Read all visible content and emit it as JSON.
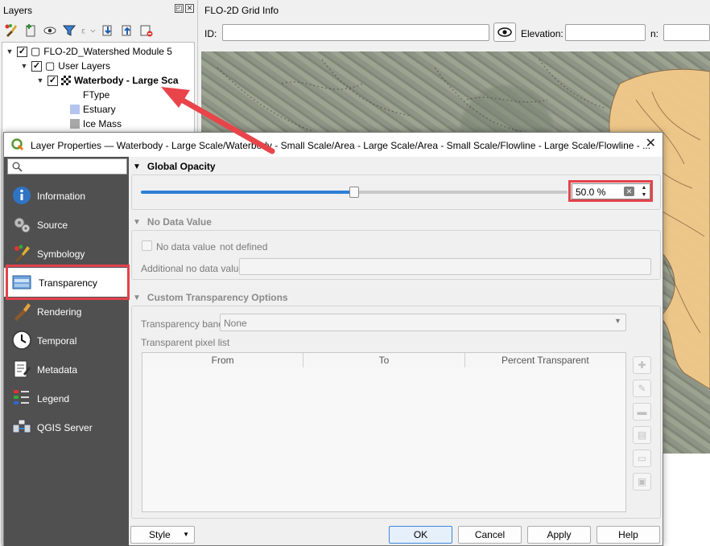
{
  "layers_panel": {
    "title": "Layers",
    "tree": [
      {
        "label": "FLO-2D_Watershed Module 5",
        "checked": true,
        "expanded": true
      },
      {
        "label": "User Layers",
        "checked": true,
        "expanded": true
      },
      {
        "label": "Waterbody - Large Sca",
        "checked": true,
        "expanded": true
      }
    ],
    "legend": {
      "field": "FType",
      "items": [
        {
          "label": "Estuary",
          "color": "#b4c4f0"
        },
        {
          "label": "Ice Mass",
          "color": "#a8a8a8"
        }
      ]
    }
  },
  "grid_info": {
    "title": "FLO-2D Grid Info",
    "id_label": "ID:",
    "id_value": "",
    "elevation_label": "Elevation:",
    "elevation_value": "",
    "n_label": "n:",
    "n_value": ""
  },
  "dialog": {
    "title": "Layer Properties — Waterbody - Large Scale/Waterbody - Small Scale/Area - Large Scale/Area - Small Scale/Flowline - Large Scale/Flowline - ...",
    "close": "✕",
    "search_placeholder": "",
    "nav": [
      {
        "label": "Information",
        "icon": "information-icon"
      },
      {
        "label": "Source",
        "icon": "source-icon"
      },
      {
        "label": "Symbology",
        "icon": "symbology-icon"
      },
      {
        "label": "Transparency",
        "icon": "transparency-icon",
        "selected": true
      },
      {
        "label": "Rendering",
        "icon": "rendering-icon"
      },
      {
        "label": "Temporal",
        "icon": "temporal-icon"
      },
      {
        "label": "Metadata",
        "icon": "metadata-icon"
      },
      {
        "label": "Legend",
        "icon": "legend-icon"
      },
      {
        "label": "QGIS Server",
        "icon": "qgis-server-icon"
      }
    ],
    "global_opacity": {
      "title": "Global Opacity",
      "value_text": "50.0 %",
      "value": 0.5
    },
    "no_data": {
      "title": "No Data Value",
      "checkbox_label": "No data value",
      "status": "not defined",
      "additional_label": "Additional no data value",
      "additional_value": ""
    },
    "custom_transparency": {
      "title": "Custom Transparency Options",
      "band_label": "Transparency band",
      "band_value": "None",
      "pixel_list_label": "Transparent pixel list",
      "columns": [
        "From",
        "To",
        "Percent Transparent"
      ]
    },
    "buttons": {
      "style": "Style",
      "ok": "OK",
      "cancel": "Cancel",
      "apply": "Apply",
      "help": "Help"
    }
  },
  "colors": {
    "accent": "#2f7fd6",
    "highlight": "#e2434b",
    "sidebar": "#505050",
    "watershed": "#f2c98a"
  }
}
